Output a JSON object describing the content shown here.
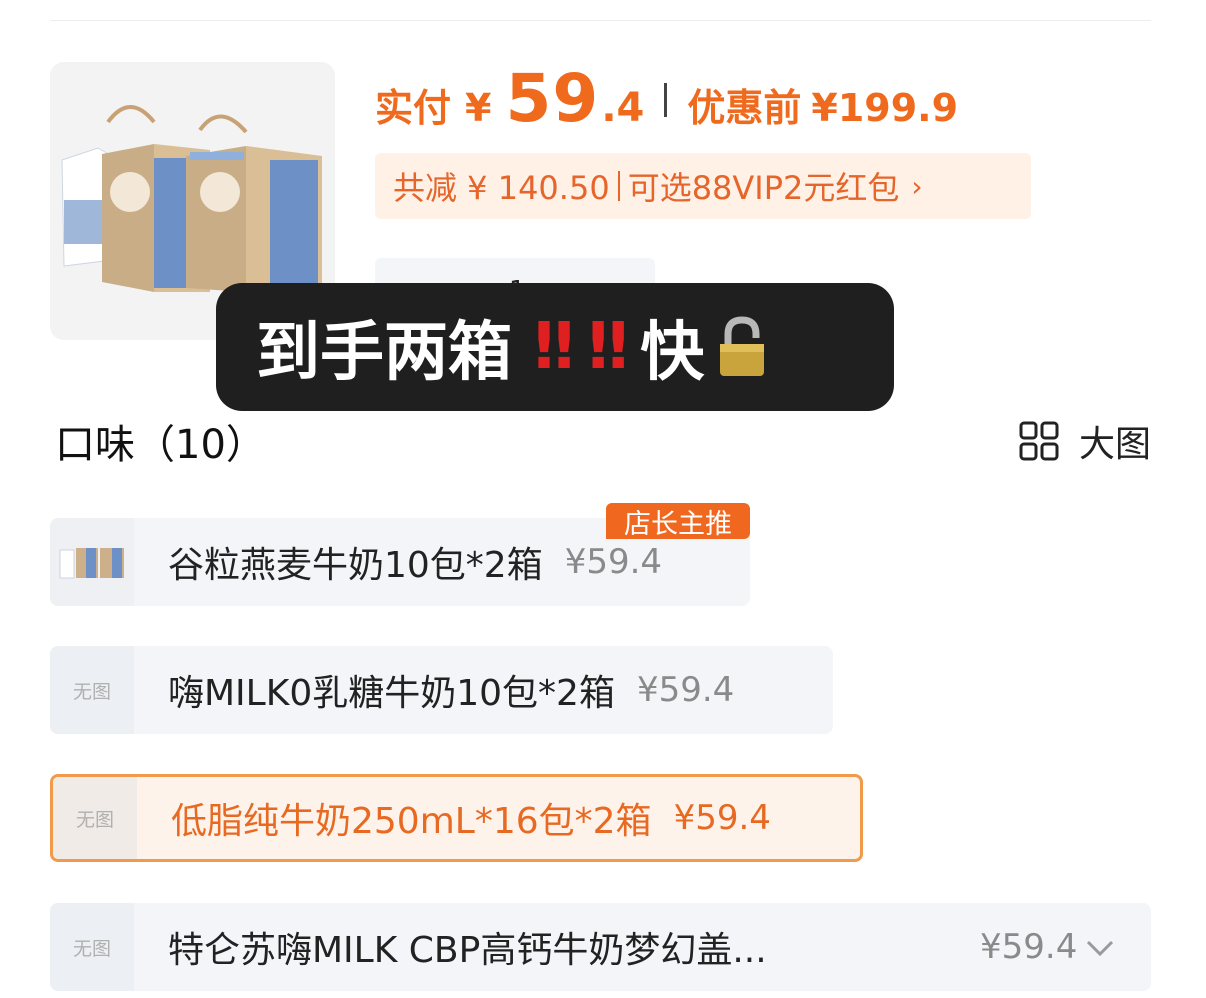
{
  "product": {
    "image_icon": "milk-box-product-image",
    "price_label": "实付",
    "price_currency": "¥",
    "price_int": "59",
    "price_dec": ".4",
    "original_label": "优惠前",
    "original_price": "¥199.9",
    "discount_text": "共减 ¥ 140.50",
    "coupon_text": "可选88VIP2元红包",
    "chevron": "›",
    "quantity": "1",
    "plus": "+"
  },
  "overlay": {
    "text_main": "到手两箱",
    "exclaim_1": "‼",
    "exclaim_2": "‼",
    "text_tail": "快",
    "lock_icon": "🔓"
  },
  "flavor": {
    "title": "口味（10）",
    "big_image_label": "大图",
    "grid_icon": "grid-icon",
    "options": [
      {
        "name": "谷粒燕麦牛奶10包*2箱",
        "price": "¥59.4",
        "image": "thumb",
        "badge": "店长主推"
      },
      {
        "name": "嗨MILK0乳糖牛奶10包*2箱",
        "price": "¥59.4",
        "image_placeholder": "无图"
      },
      {
        "name": "低脂纯牛奶250mL*16包*2箱",
        "price": "¥59.4",
        "image_placeholder": "无图",
        "selected": true
      },
      {
        "name": "特仑苏嗨MILK CBP高钙牛奶梦幻盖...",
        "price": "¥59.4",
        "image_placeholder": "无图",
        "expand_icon": "chevron-down-icon"
      }
    ]
  },
  "colors": {
    "accent": "#f06a1d",
    "discount_bg": "#fff1e5",
    "option_bg": "#f3f5f9",
    "selected_border": "#f19a4c",
    "overlay_bg": "#1f1f1f",
    "exclaim": "#e02020"
  }
}
